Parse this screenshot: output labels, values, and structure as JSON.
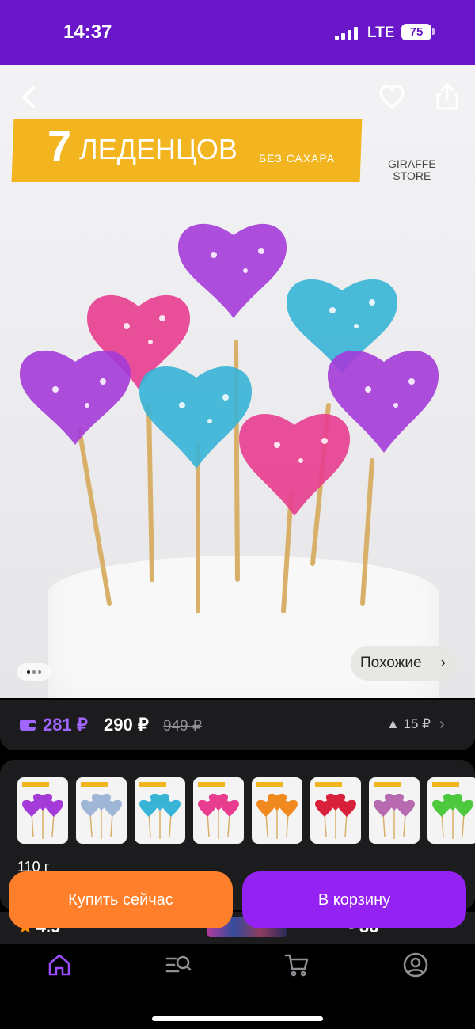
{
  "status_bar": {
    "time": "14:37",
    "network": "LTE",
    "battery": "75"
  },
  "hero": {
    "banner_number": "7",
    "banner_word": "ЛЕДЕНЦОВ",
    "banner_sub": "БЕЗ САХАРА",
    "store_logo": "GIRAFFE\nSTORE",
    "similar_label": "Похожие",
    "similar_chevron": "›",
    "page_dots": 3,
    "active_dot": 0
  },
  "price": {
    "wallet_price": "281 ₽",
    "price": "290 ₽",
    "old_price": "949 ₽",
    "drop": "▲ 15 ₽",
    "chevron": "›"
  },
  "variants": {
    "items": [
      {
        "color": "#a43bd8"
      },
      {
        "color": "#9fb6d6"
      },
      {
        "color": "#37b4d6"
      },
      {
        "color": "#e83d8f"
      },
      {
        "color": "#f08a1e"
      },
      {
        "color": "#d8203a"
      },
      {
        "color": "#b86ab0"
      },
      {
        "color": "#4cc93c"
      }
    ],
    "weight": "110 г"
  },
  "info_row": {
    "rating": "4.9",
    "reviews": "36"
  },
  "actions": {
    "buy_now": "Купить сейчас",
    "add_to_cart": "В корзину"
  },
  "tabs": [
    {
      "icon": "home-icon",
      "active": true
    },
    {
      "icon": "catalog-search-icon",
      "active": false
    },
    {
      "icon": "cart-icon",
      "active": false
    },
    {
      "icon": "profile-icon",
      "active": false
    }
  ],
  "colors": {
    "brand": "#6a17c9",
    "accent_purple": "#9322f3",
    "accent_orange": "#ff7f2a",
    "banner_yellow": "#f2b51f"
  }
}
